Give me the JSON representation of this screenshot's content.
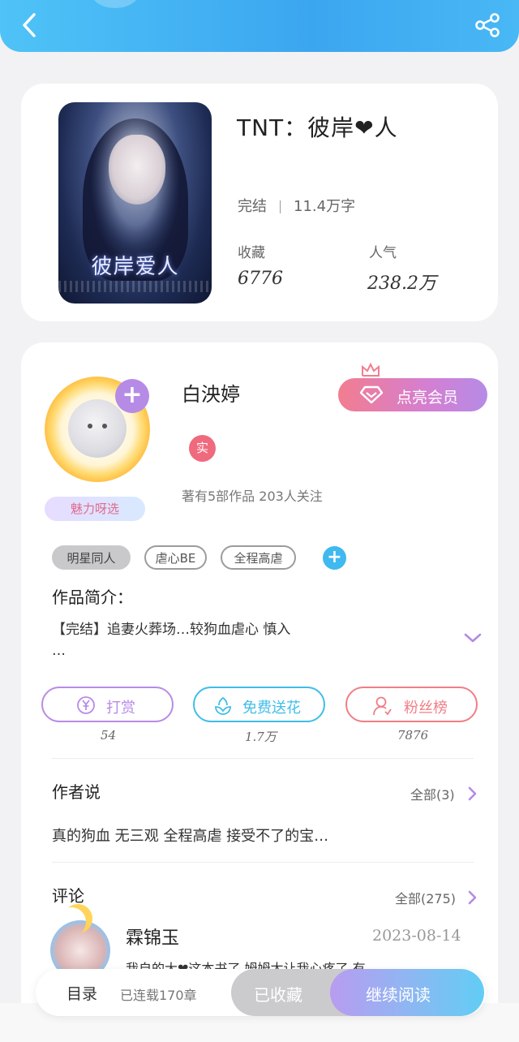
{
  "book": {
    "title": "TNT：彼岸❤人",
    "cover_title": "彼岸爱人",
    "status": "完结",
    "word_count": "11.4万字",
    "favorites_label": "收藏",
    "favorites_value": "6776",
    "popularity_label": "人气",
    "popularity_value": "238.2万"
  },
  "author": {
    "name": "白泱婷",
    "real_badge": "实",
    "info": "著有5部作品 203人关注",
    "charm_badge": "魅力呀选",
    "vip_button": "点亮会员"
  },
  "tags": [
    "明星同人",
    "虐心BE",
    "全程高虐"
  ],
  "intro": {
    "heading": "作品简介：",
    "text": "【完结】追妻火葬场…较狗血虐心 慎入",
    "ellipsis": "…"
  },
  "actions": [
    {
      "label": "打赏",
      "count": "54",
      "icon": "yen-icon",
      "color": "#b88be6"
    },
    {
      "label": "免费送花",
      "count": "1.7万",
      "icon": "flower-icon",
      "color": "#3fbde8"
    },
    {
      "label": "粉丝榜",
      "count": "7876",
      "icon": "user-icon",
      "color": "#f07e86"
    }
  ],
  "author_says": {
    "heading": "作者说",
    "more": "全部(3)",
    "text": "真的狗血 无三观 全程高虐 接受不了的宝…"
  },
  "comments": {
    "heading": "评论",
    "more": "全部(275)",
    "items": [
      {
        "name": "霖锦玉",
        "date": "2023-08-14",
        "text": "我自的大❤这本书了 姆姆太让我心疼了 有"
      }
    ]
  },
  "bottom_bar": {
    "toc": "目录",
    "serial": "已连载170章",
    "collected": "已收藏",
    "continue": "继续阅读"
  },
  "colors": {
    "header_start": "#4fc3f7",
    "header_end": "#3ba6f0",
    "vip_start": "#f27d8f",
    "vip_end": "#b58be6",
    "tag_add": "#3fb9f0"
  }
}
